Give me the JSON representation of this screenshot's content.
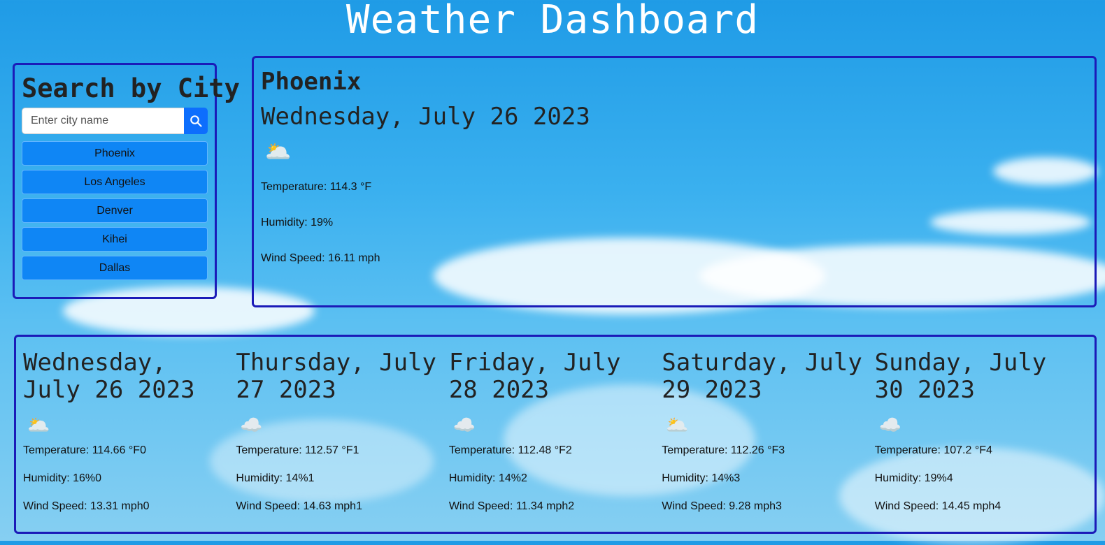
{
  "page": {
    "title": "Weather Dashboard"
  },
  "search": {
    "title": "Search by City",
    "placeholder": "Enter city name",
    "history": [
      "Phoenix",
      "Los Angeles",
      "Denver",
      "Kihei",
      "Dallas"
    ]
  },
  "current": {
    "city": "Phoenix",
    "date": "Wednesday, July 26 2023",
    "icon": "partly-sunny-icon",
    "temperature": "Temperature: 114.3 °F",
    "humidity": "Humidity: 19%",
    "wind": "Wind Speed: 16.11 mph"
  },
  "forecast": [
    {
      "date": "Wednesday, July 26 2023",
      "icon": "partly-sunny-icon",
      "temperature": "Temperature: 114.66 °F0",
      "humidity": "Humidity: 16%0",
      "wind": "Wind Speed: 13.31 mph0"
    },
    {
      "date": "Thursday, July 27 2023",
      "icon": "cloud-icon",
      "temperature": "Temperature: 112.57 °F1",
      "humidity": "Humidity: 14%1",
      "wind": "Wind Speed: 14.63 mph1"
    },
    {
      "date": "Friday, July 28 2023",
      "icon": "broken-clouds-icon",
      "temperature": "Temperature: 112.48 °F2",
      "humidity": "Humidity: 14%2",
      "wind": "Wind Speed: 11.34 mph2"
    },
    {
      "date": "Saturday, July 29 2023",
      "icon": "partly-sunny-icon",
      "temperature": "Temperature: 112.26 °F3",
      "humidity": "Humidity: 14%3",
      "wind": "Wind Speed: 9.28 mph3"
    },
    {
      "date": "Sunday, July 30 2023",
      "icon": "cloud-icon",
      "temperature": "Temperature: 107.2 °F4",
      "humidity": "Humidity: 19%4",
      "wind": "Wind Speed: 14.45 mph4"
    }
  ],
  "colors": {
    "accent": "#0d6efd",
    "border": "#1b1bb8",
    "button": "#0f86f5"
  }
}
